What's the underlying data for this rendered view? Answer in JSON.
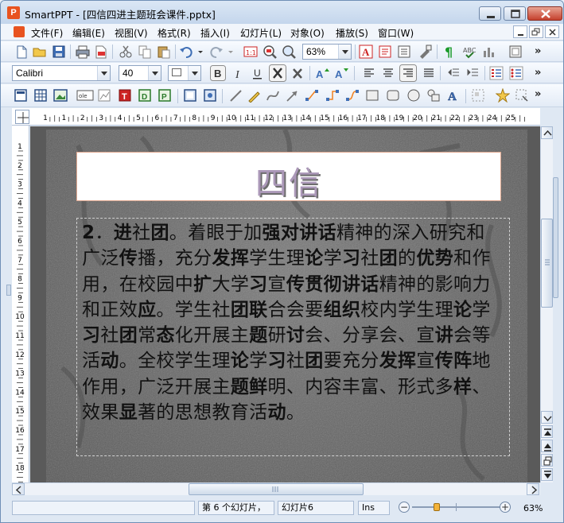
{
  "window": {
    "title": "SmartPPT - [四信四进主题班会课件.pptx]",
    "app_icon": "P"
  },
  "menu": [
    {
      "label": "文件(F)"
    },
    {
      "label": "编辑(E)"
    },
    {
      "label": "视图(V)"
    },
    {
      "label": "格式(R)"
    },
    {
      "label": "插入(I)"
    },
    {
      "label": "幻灯片(L)"
    },
    {
      "label": "对象(O)"
    },
    {
      "label": "播放(S)"
    },
    {
      "label": "窗口(W)"
    }
  ],
  "toolbar": {
    "zoom_value": "63%",
    "font_name": "Calibri",
    "font_size": "40",
    "more": "»"
  },
  "ruler": {
    "h_ticks": [
      "1",
      "1",
      "2",
      "3",
      "4",
      "5",
      "6",
      "7",
      "8",
      "9",
      "10",
      "11",
      "12",
      "13",
      "14",
      "15",
      "16",
      "17",
      "18",
      "19",
      "20",
      "21",
      "22",
      "23",
      "24",
      "25"
    ],
    "v_ticks": [
      "1",
      "2",
      "3",
      "4",
      "5",
      "6",
      "7",
      "8",
      "9",
      "10",
      "11",
      "12",
      "13",
      "14",
      "15",
      "16",
      "17",
      "18"
    ]
  },
  "slide": {
    "title": "四信",
    "body_html": "<b>2</b>．<b>进</b>社<b>团</b>。着眼于加<b>强对讲话</b>精神的深入研究和广泛<b>传</b>播，充分<b>发挥</b>学生理<b>论</b>学<b>习</b>社<b>团</b>的<b>优势</b>和作用，在校园中<b>扩</b>大学<b>习</b>宣<b>传贯彻讲话</b>精神的影响力和正效<b>应</b>。学生社<b>团联</b>合会要<b>组织</b>校内学生理<b>论</b>学<b>习</b>社<b>团</b>常<b>态</b>化开展主<b>题</b>研<b>讨</b>会、分享会、宣<b>讲</b>会等活<b>动</b>。全校学生理<b>论</b>学<b>习</b>社<b>团</b>要充分<b>发挥</b>宣<b>传阵</b>地作用，广泛开展主<b>题鲜</b>明、内容丰富、形式多<b>样</b>、效果<b>显</b>著的思想教育活<b>动</b>。"
  },
  "status": {
    "slide_count": "第 6 个幻灯片，",
    "slide_name": "幻灯片6",
    "mode": "Ins",
    "zoom": "63%"
  },
  "colors": {
    "title_fill": "#ab98b8",
    "slide_bg": "#6a6a6a",
    "app_accent": "#e8531f"
  }
}
